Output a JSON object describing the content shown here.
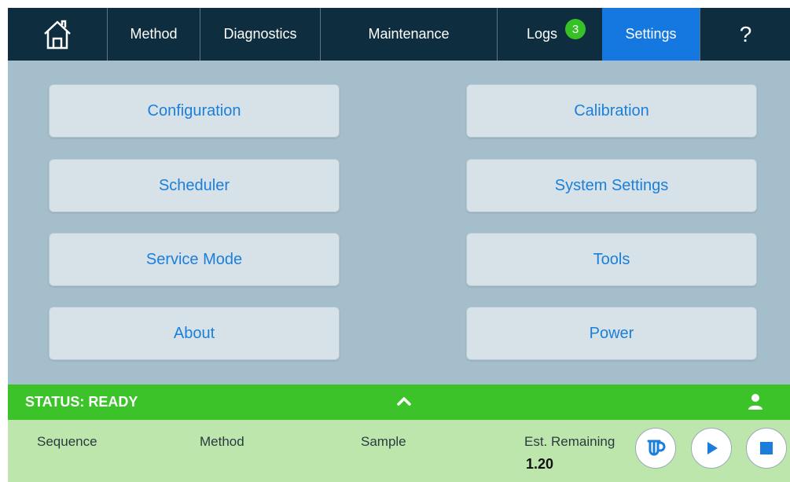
{
  "nav": {
    "method": "Method",
    "diagnostics": "Diagnostics",
    "maintenance": "Maintenance",
    "logs": "Logs",
    "logs_badge": "3",
    "settings": "Settings",
    "help": "?"
  },
  "settings_menu": {
    "configuration": "Configuration",
    "calibration": "Calibration",
    "scheduler": "Scheduler",
    "system_settings": "System Settings",
    "service_mode": "Service Mode",
    "tools": "Tools",
    "about": "About",
    "power": "Power"
  },
  "status": {
    "text": "STATUS: READY"
  },
  "run_info": {
    "sequence_label": "Sequence",
    "method_label": "Method",
    "sample_label": "Sample",
    "remaining_label": "Est. Remaining",
    "remaining_value": "1.20"
  },
  "colors": {
    "nav_bg": "#0e2e3f",
    "active_tab": "#1577e0",
    "content_bg": "#a4bfcb",
    "status_ready": "#3cc32a",
    "info_bg": "#bde6ac",
    "accent_text": "#1b7fd9"
  },
  "icons": [
    "home-icon",
    "chevron-up-icon",
    "user-icon",
    "sample-cup-icon",
    "play-icon",
    "stop-icon"
  ]
}
